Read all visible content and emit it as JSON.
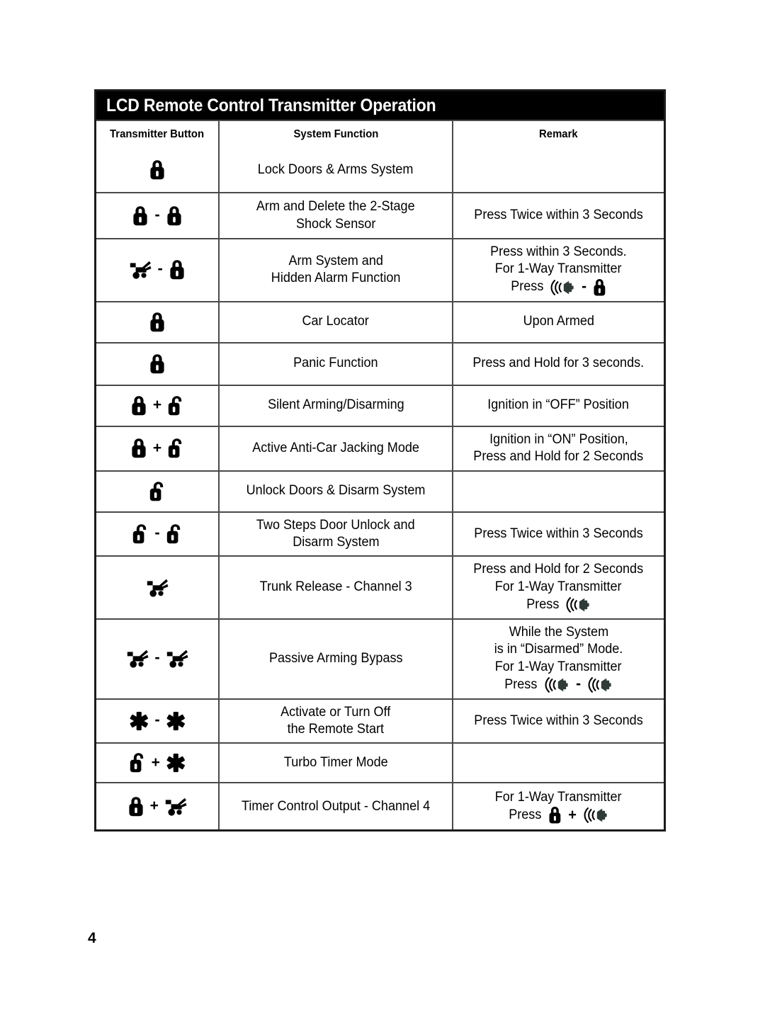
{
  "page": {
    "number": "4"
  },
  "table": {
    "title": "LCD Remote Control Transmitter Operation",
    "headers": {
      "button": "Transmitter Button",
      "function": "System Function",
      "remark": "Remark"
    },
    "rows": [
      {
        "id": "lock-doors-arms-system",
        "buttons": [
          "lock-closed-icon"
        ],
        "operators": [],
        "function": [
          "Lock Doors & Arms System"
        ],
        "remark": []
      },
      {
        "id": "arm-delete-2stage-shock-sensor",
        "buttons": [
          "lock-closed-icon",
          "lock-closed-icon"
        ],
        "operators": [
          "-"
        ],
        "function": [
          "Arm and Delete the 2-Stage",
          "Shock Sensor"
        ],
        "remark": [
          "Press Twice within 3 Seconds"
        ]
      },
      {
        "id": "arm-system-hidden-alarm-function",
        "buttons": [
          "trunk-icon",
          "lock-closed-icon"
        ],
        "operators": [
          "-"
        ],
        "function": [
          "Arm System and",
          "Hidden Alarm Function"
        ],
        "remark": [
          "Press within 3 Seconds.",
          "For 1-Way Transmitter"
        ],
        "remark_icon_line": {
          "prefix": "Press",
          "icons": [
            "horn-icon",
            "lock-closed-icon"
          ],
          "operators": [
            "-"
          ]
        }
      },
      {
        "id": "car-locator",
        "buttons": [
          "lock-closed-icon"
        ],
        "operators": [],
        "function": [
          "Car Locator"
        ],
        "remark": [
          "Upon Armed"
        ]
      },
      {
        "id": "panic-function",
        "buttons": [
          "lock-closed-icon"
        ],
        "operators": [],
        "function": [
          "Panic Function"
        ],
        "remark": [
          "Press and Hold for 3 seconds."
        ]
      },
      {
        "id": "silent-arming-disarming",
        "buttons": [
          "lock-closed-icon",
          "lock-open-icon"
        ],
        "operators": [
          "+"
        ],
        "function": [
          "Silent Arming/Disarming"
        ],
        "remark": [
          "Ignition in “OFF” Position"
        ]
      },
      {
        "id": "active-anti-car-jacking-mode",
        "buttons": [
          "lock-closed-icon",
          "lock-open-icon"
        ],
        "operators": [
          "+"
        ],
        "function": [
          "Active Anti-Car Jacking Mode"
        ],
        "remark": [
          "Ignition in “ON” Position,",
          "Press and Hold for 2 Seconds"
        ]
      },
      {
        "id": "unlock-doors-disarm-system",
        "buttons": [
          "lock-open-icon"
        ],
        "operators": [],
        "function": [
          "Unlock Doors & Disarm System"
        ],
        "remark": []
      },
      {
        "id": "two-steps-door-unlock-disarm",
        "buttons": [
          "lock-open-icon",
          "lock-open-icon"
        ],
        "operators": [
          "-"
        ],
        "function": [
          "Two Steps Door Unlock and",
          "Disarm System"
        ],
        "remark": [
          "Press Twice within 3 Seconds"
        ]
      },
      {
        "id": "trunk-release-channel-3",
        "buttons": [
          "trunk-icon"
        ],
        "operators": [],
        "function": [
          "Trunk Release - Channel 3"
        ],
        "remark": [
          "Press and Hold for 2 Seconds",
          "For 1-Way Transmitter"
        ],
        "remark_icon_line": {
          "prefix": "Press",
          "icons": [
            "horn-icon"
          ],
          "operators": []
        }
      },
      {
        "id": "passive-arming-bypass",
        "buttons": [
          "trunk-icon",
          "trunk-icon"
        ],
        "operators": [
          "-"
        ],
        "function": [
          "Passive Arming Bypass"
        ],
        "remark": [
          "While the System",
          "is in “Disarmed” Mode.",
          "For 1-Way Transmitter"
        ],
        "remark_icon_line": {
          "prefix": "Press",
          "icons": [
            "horn-icon",
            "horn-icon"
          ],
          "operators": [
            "-"
          ]
        }
      },
      {
        "id": "activate-turn-off-remote-start",
        "buttons": [
          "star-icon",
          "star-icon"
        ],
        "operators": [
          "-"
        ],
        "function": [
          "Activate or Turn Off",
          "the Remote Start"
        ],
        "remark": [
          "Press Twice within 3 Seconds"
        ]
      },
      {
        "id": "turbo-timer-mode",
        "buttons": [
          "lock-open-icon",
          "star-icon"
        ],
        "operators": [
          "+"
        ],
        "function": [
          "Turbo Timer Mode"
        ],
        "remark": []
      },
      {
        "id": "timer-control-output-channel-4",
        "buttons": [
          "lock-closed-icon",
          "trunk-icon"
        ],
        "operators": [
          "+"
        ],
        "function": [
          "Timer Control Output - Channel 4"
        ],
        "remark": [
          "For 1-Way Transmitter"
        ],
        "remark_icon_line": {
          "prefix": "Press",
          "icons": [
            "lock-closed-icon",
            "horn-icon"
          ],
          "operators": [
            "+"
          ]
        }
      }
    ]
  },
  "colors": {
    "title_bar_background": "#000000",
    "title_bar_text": "#ffffff",
    "table_border": "#1c1c1c",
    "grid_line": "#4a4a4a",
    "body_text": "#000000",
    "page_background": "#ffffff"
  }
}
